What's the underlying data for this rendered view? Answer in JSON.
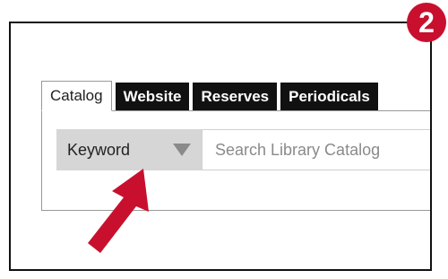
{
  "step_badge": {
    "label": "2",
    "color": "#c8102e"
  },
  "tabs": [
    {
      "label": "Catalog",
      "active": true
    },
    {
      "label": "Website",
      "active": false
    },
    {
      "label": "Reserves",
      "active": false
    },
    {
      "label": "Periodicals",
      "active": false
    }
  ],
  "search": {
    "scope_selected": "Keyword",
    "placeholder": "Search Library Catalog",
    "value": ""
  },
  "pointer": {
    "icon": "arrow-pointer-icon",
    "color": "#c8102e"
  }
}
